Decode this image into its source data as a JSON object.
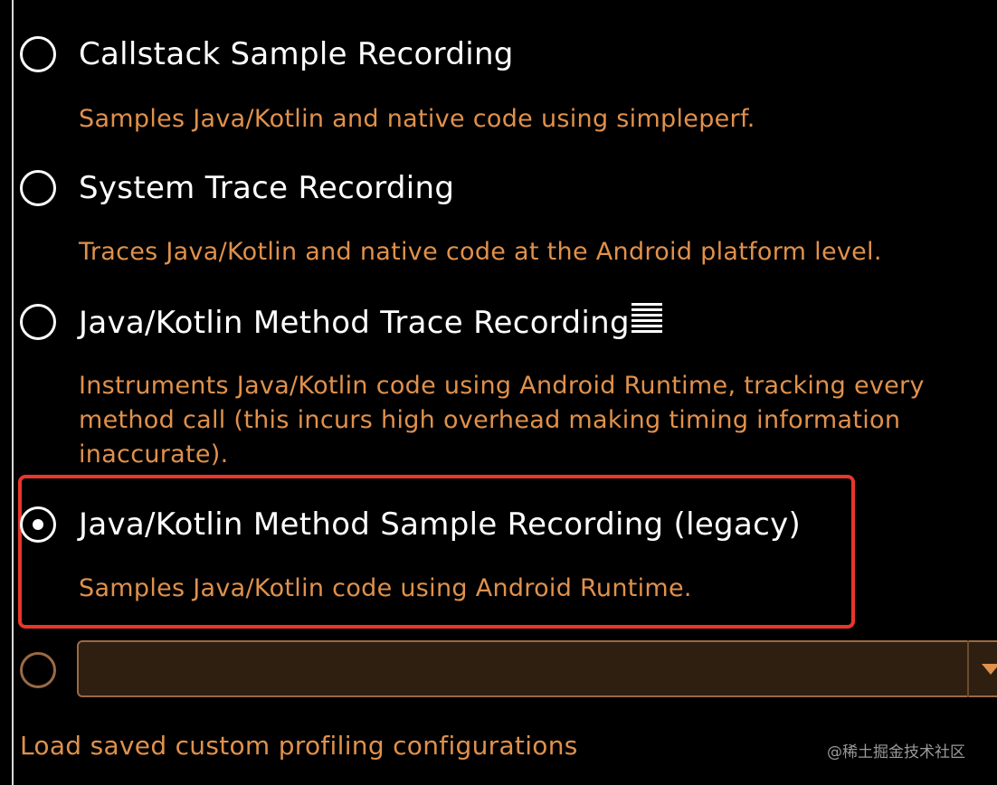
{
  "options": [
    {
      "title": "Callstack Sample Recording",
      "description": "Samples Java/Kotlin and native code using simpleperf.",
      "selected": false
    },
    {
      "title": "System Trace Recording",
      "description": "Traces Java/Kotlin and native code at the Android platform level.",
      "selected": false
    },
    {
      "title": "Java/Kotlin Method Trace Recording",
      "description": "Instruments Java/Kotlin code using Android Runtime, tracking every method call (this incurs high overhead making timing information inaccurate).",
      "selected": false
    },
    {
      "title": "Java/Kotlin Method Sample Recording (legacy)",
      "description": "Samples Java/Kotlin code using Android Runtime.",
      "selected": true
    }
  ],
  "custom_config": {
    "selected": false,
    "value": ""
  },
  "load_link": "Load saved custom profiling configurations",
  "watermark": "@稀土掘金技术社区",
  "colors": {
    "background": "#000000",
    "title": "#ffffff",
    "description": "#e0914c",
    "highlight_border": "#e8362b",
    "select_background": "#2e1f10",
    "select_border": "#9a6a45"
  }
}
